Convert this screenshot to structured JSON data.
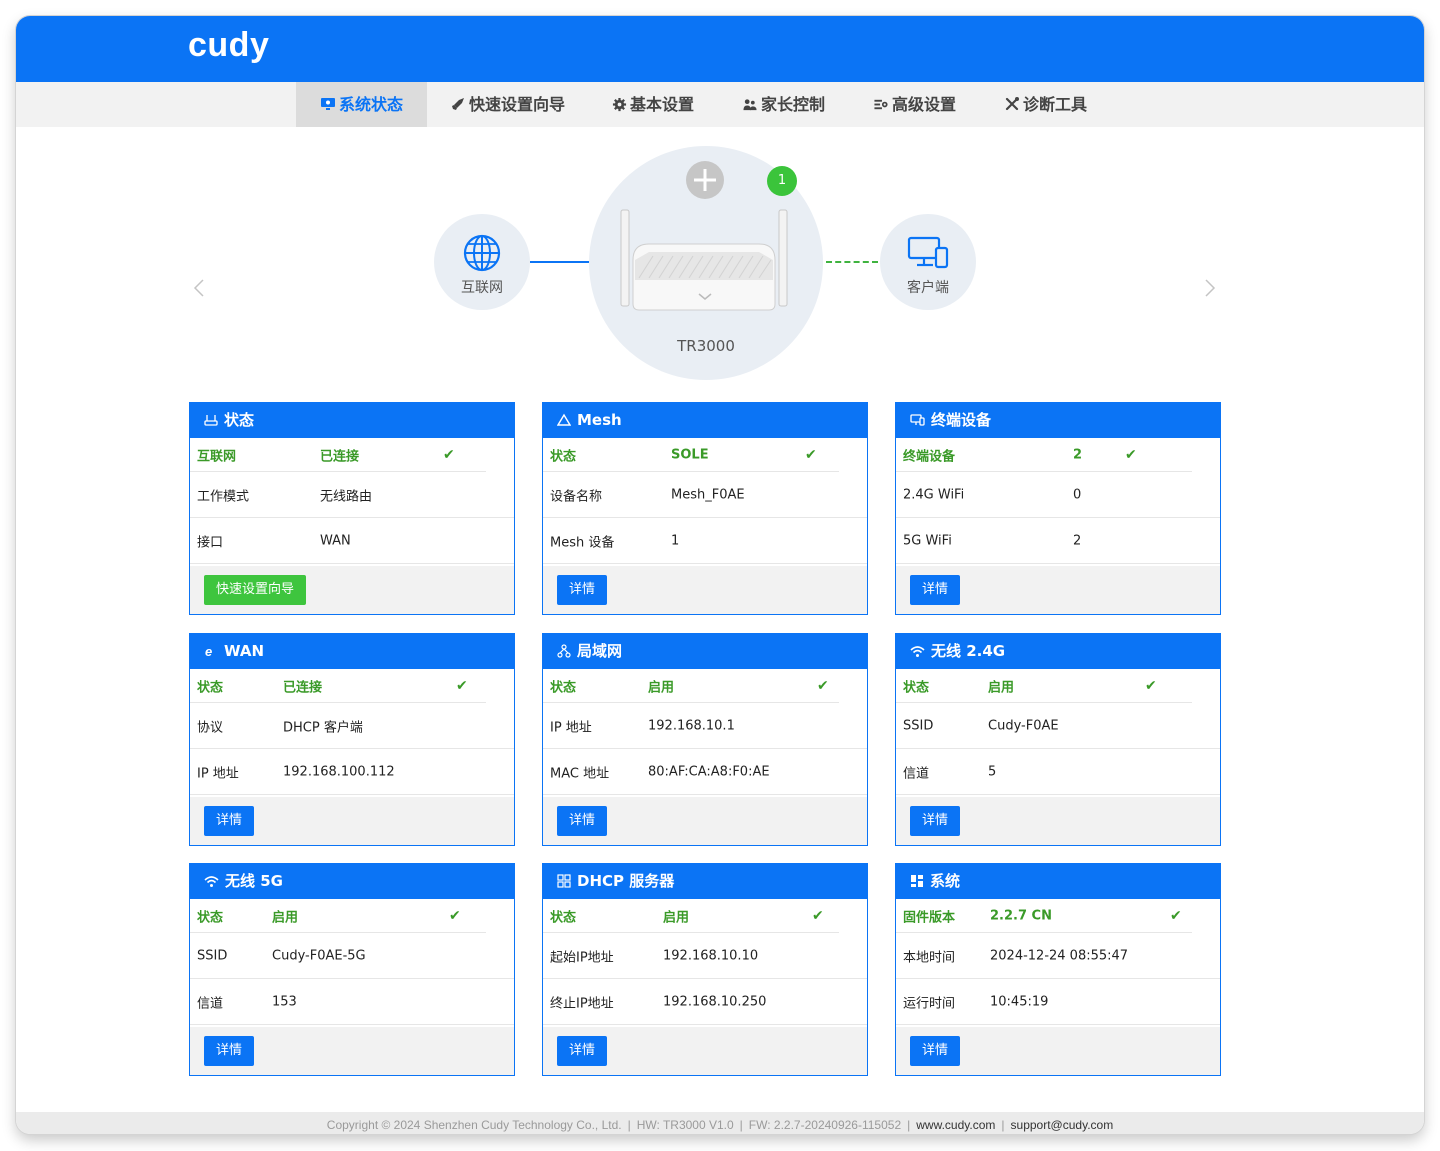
{
  "brand": {
    "logo": "cudy",
    "color": "#0b74f5"
  },
  "nav": {
    "items": [
      {
        "label": "系统状态",
        "icon": "monitor-icon",
        "active": true
      },
      {
        "label": "快速设置向导",
        "icon": "rocket-icon",
        "active": false
      },
      {
        "label": "基本设置",
        "icon": "gear-icon",
        "active": false
      },
      {
        "label": "家长控制",
        "icon": "family-icon",
        "active": false
      },
      {
        "label": "高级设置",
        "icon": "sliders-icon",
        "active": false
      },
      {
        "label": "诊断工具",
        "icon": "tools-icon",
        "active": false
      }
    ]
  },
  "topology": {
    "internet_label": "互联网",
    "router_model": "TR3000",
    "mesh_count": "1",
    "client_label": "客户端"
  },
  "cards": {
    "status": {
      "title": "状态",
      "rows": [
        {
          "k": "互联网",
          "v": "已连接"
        },
        {
          "k": "工作模式",
          "v": "无线路由"
        },
        {
          "k": "接口",
          "v": "WAN"
        }
      ],
      "button": "快速设置向导"
    },
    "mesh": {
      "title": "Mesh",
      "rows": [
        {
          "k": "状态",
          "v": "SOLE"
        },
        {
          "k": "设备名称",
          "v": "Mesh_F0AE"
        },
        {
          "k": "Mesh 设备",
          "v": "1"
        }
      ],
      "button": "详情"
    },
    "devices": {
      "title": "终端设备",
      "rows": [
        {
          "k": "终端设备",
          "v": "2"
        },
        {
          "k": "2.4G WiFi",
          "v": "0"
        },
        {
          "k": "5G WiFi",
          "v": "2"
        }
      ],
      "button": "详情"
    },
    "wan": {
      "title": "WAN",
      "rows": [
        {
          "k": "状态",
          "v": "已连接"
        },
        {
          "k": "协议",
          "v": "DHCP 客户端"
        },
        {
          "k": "IP 地址",
          "v": "192.168.100.112"
        }
      ],
      "button": "详情"
    },
    "lan": {
      "title": "局域网",
      "rows": [
        {
          "k": "状态",
          "v": "启用"
        },
        {
          "k": "IP 地址",
          "v": "192.168.10.1"
        },
        {
          "k": "MAC 地址",
          "v": "80:AF:CA:A8:F0:AE"
        }
      ],
      "button": "详情"
    },
    "wifi24": {
      "title": "无线 2.4G",
      "rows": [
        {
          "k": "状态",
          "v": "启用"
        },
        {
          "k": "SSID",
          "v": "Cudy-F0AE"
        },
        {
          "k": "信道",
          "v": "5"
        }
      ],
      "button": "详情"
    },
    "wifi5": {
      "title": "无线 5G",
      "rows": [
        {
          "k": "状态",
          "v": "启用"
        },
        {
          "k": "SSID",
          "v": "Cudy-F0AE-5G"
        },
        {
          "k": "信道",
          "v": "153"
        }
      ],
      "button": "详情"
    },
    "dhcp": {
      "title": "DHCP 服务器",
      "rows": [
        {
          "k": "状态",
          "v": "启用"
        },
        {
          "k": "起始IP地址",
          "v": "192.168.10.10"
        },
        {
          "k": "终止IP地址",
          "v": "192.168.10.250"
        }
      ],
      "button": "详情"
    },
    "system": {
      "title": "系统",
      "rows": [
        {
          "k": "固件版本",
          "v": "2.2.7 CN"
        },
        {
          "k": "本地时间",
          "v": "2024-12-24 08:55:47"
        },
        {
          "k": "运行时间",
          "v": "10:45:19"
        }
      ],
      "button": "详情"
    }
  },
  "footer": {
    "copyright": "Copyright © 2024 Shenzhen Cudy Technology Co., Ltd.",
    "hw": "HW: TR3000 V1.0",
    "fw": "FW: 2.2.7-20240926-115052",
    "site": "www.cudy.com",
    "email": "support@cudy.com"
  },
  "colors": {
    "accent": "#0b74f5",
    "ok_green": "#3a9a28",
    "button_green": "#3ec53e",
    "panel_gray": "#f2f2f2"
  }
}
